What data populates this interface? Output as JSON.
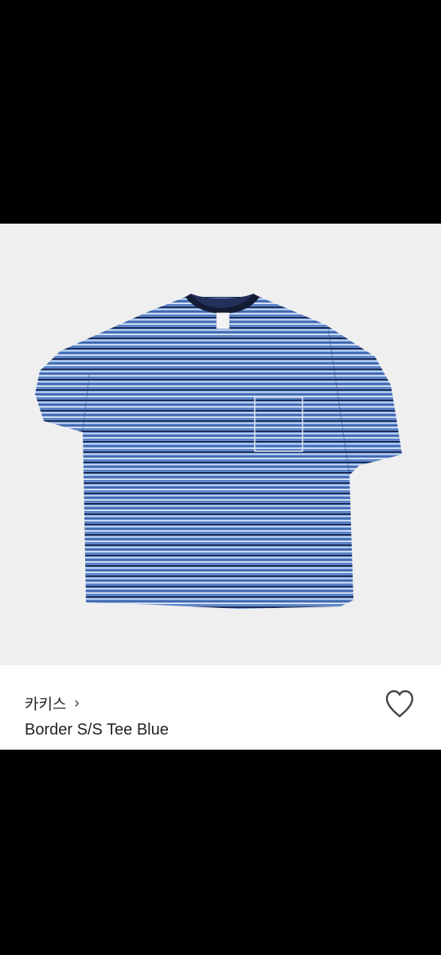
{
  "product": {
    "brand": "카키스",
    "brand_chevron": "›",
    "title": "Border S/S Tee Blue"
  },
  "icons": {
    "wishlist": "heart-outline-icon",
    "brand_link": "chevron-right-icon"
  },
  "colors": {
    "photo_background": "#efefef",
    "tee_base": "#6f9ad8",
    "collar": "#141c33"
  }
}
